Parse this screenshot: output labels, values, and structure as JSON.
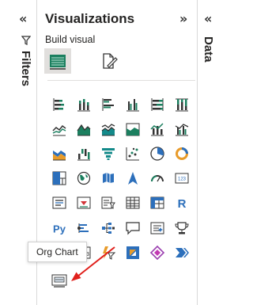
{
  "filters_pane": {
    "collapse_icon": "chevrons-left-icon",
    "filter_icon": "funnel-icon",
    "label": "Filters"
  },
  "visualizations": {
    "title": "Visualizations",
    "expand_icon": "chevrons-right-icon",
    "build_visual_label": "Build visual",
    "build_buttons": [
      {
        "name": "build-visual-button",
        "icon": "build-visual-icon",
        "active": true
      },
      {
        "name": "format-visual-button",
        "icon": "format-visual-icon",
        "active": false
      }
    ],
    "visuals": [
      "stacked-bar-chart-icon",
      "stacked-column-chart-icon",
      "clustered-bar-chart-icon",
      "clustered-column-chart-icon",
      "100-stacked-bar-chart-icon",
      "100-stacked-column-chart-icon",
      "line-chart-icon",
      "area-chart-icon",
      "stacked-area-chart-icon",
      "100-stacked-area-chart-icon",
      "line-and-stacked-column-chart-icon",
      "line-and-clustered-column-chart-icon",
      "ribbon-chart-icon",
      "waterfall-chart-icon",
      "funnel-icon",
      "scatter-chart-icon",
      "pie-chart-icon",
      "donut-chart-icon",
      "treemap-icon",
      "map-icon",
      "filled-map-icon",
      "azure-map-icon",
      "gauge-icon",
      "card-icon",
      "multi-row-card-icon",
      "kpi-icon",
      "slicer-icon",
      "table-icon",
      "matrix-icon",
      "r-visual-icon",
      "python-visual-icon",
      "key-influencers-icon",
      "decomposition-tree-icon",
      "qa-icon",
      "smart-narrative-icon",
      "goals-icon",
      "paginated-report-icon",
      "power-apps-icon",
      "power-automate-icon",
      "custom-visual-icon",
      "custom-visual-icon",
      "more-visuals-icon"
    ],
    "tooltip": "Org Chart",
    "org_chart_icon": "org-chart-icon"
  },
  "data_pane": {
    "collapse_icon": "chevrons-left-icon",
    "label": "Data"
  },
  "colors": {
    "dark": "#333333",
    "accent_green": "#1b7f5f",
    "teal": "#138a8a",
    "blue": "#2c6fbb",
    "orange": "#e89b2a",
    "arrow": "#e0201c"
  }
}
